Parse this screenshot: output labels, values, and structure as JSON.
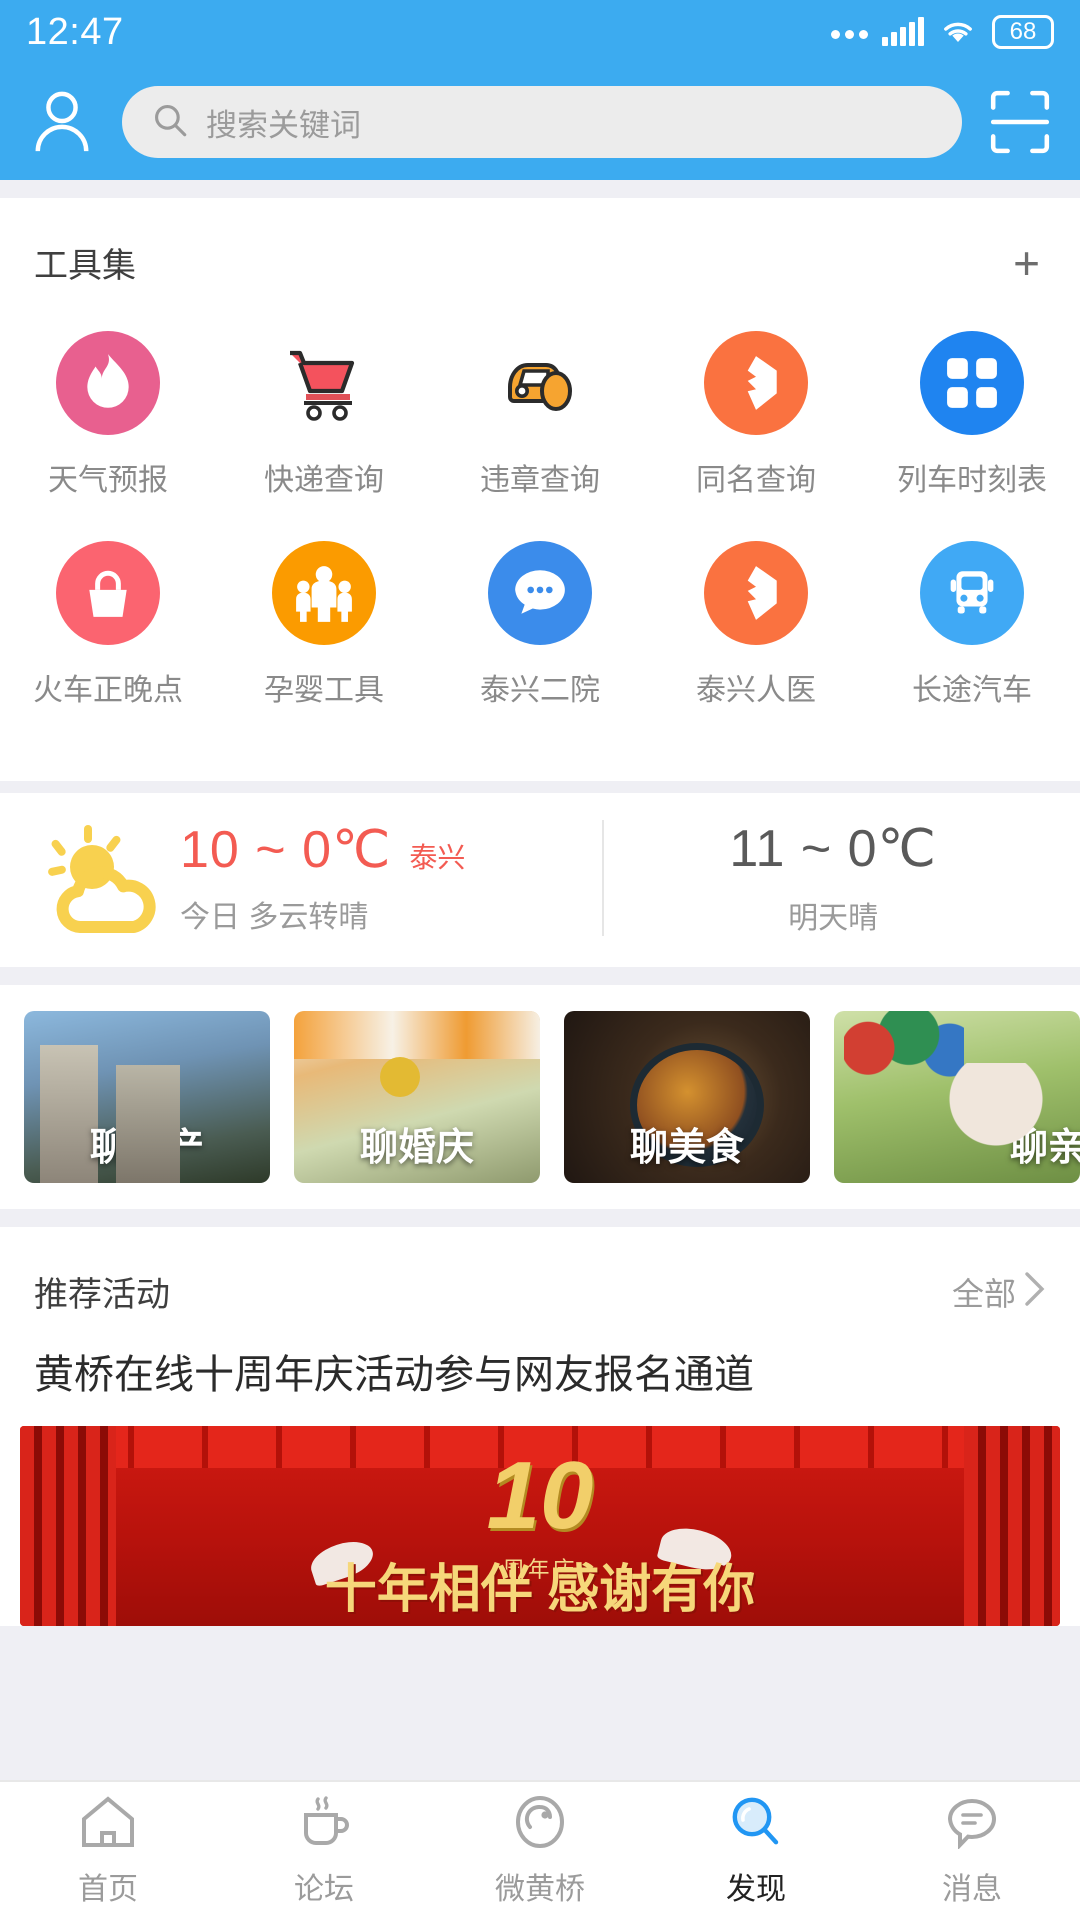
{
  "status_bar": {
    "time": "12:47",
    "battery": "68",
    "icons": [
      "more-dots-icon",
      "cellular-signal-icon",
      "wifi-icon",
      "battery-icon"
    ]
  },
  "header": {
    "profile_icon": "person-icon",
    "search": {
      "placeholder": "搜索关键词",
      "icon": "search-icon"
    },
    "scan_icon": "scan-icon",
    "bg_color": "#3cabf0"
  },
  "toolset": {
    "title": "工具集",
    "add_label": "+",
    "items": [
      {
        "label": "天气预报",
        "icon": "flame-icon",
        "bg": "#e8608f",
        "fg": "#ffffff"
      },
      {
        "label": "快递查询",
        "icon": "shopping-cart-icon",
        "bg": "transparent",
        "fg": "#f4525d"
      },
      {
        "label": "违章查询",
        "icon": "car-icon",
        "bg": "transparent",
        "fg": "#f6a430"
      },
      {
        "label": "同名查询",
        "icon": "bolt-tag-icon",
        "bg": "#fa7240",
        "fg": "#ffffff"
      },
      {
        "label": "列车时刻表",
        "icon": "grid-blocks-icon",
        "bg": "#1f84f0",
        "fg": "#ffffff"
      },
      {
        "label": "火车正晚点",
        "icon": "basket-icon",
        "bg": "#fb6470",
        "fg": "#ffffff"
      },
      {
        "label": "孕婴工具",
        "icon": "family-icon",
        "bg": "#fb9b00",
        "fg": "#ffffff"
      },
      {
        "label": "泰兴二院",
        "icon": "chat-bubble-icon",
        "bg": "#3b8ceb",
        "fg": "#ffffff"
      },
      {
        "label": "泰兴人医",
        "icon": "bolt-tag-icon",
        "bg": "#fa7240",
        "fg": "#ffffff"
      },
      {
        "label": "长途汽车",
        "icon": "bus-icon",
        "bg": "#40a9f5",
        "fg": "#ffffff"
      }
    ]
  },
  "weather": {
    "icon": "sun-cloud-icon",
    "today": {
      "temp": "10 ~ 0℃",
      "city": "泰兴",
      "desc": "今日 多云转晴",
      "color": "#f35b52"
    },
    "tomorrow": {
      "temp": "11 ~ 0℃",
      "desc": "明天晴",
      "color": "#5a5a5a"
    }
  },
  "chat_cards": [
    {
      "label": "聊房产",
      "image": "apartment-buildings-photo"
    },
    {
      "label": "聊婚庆",
      "image": "wedding-tent-photo"
    },
    {
      "label": "聊美食",
      "image": "noodle-bowl-photo"
    },
    {
      "label": "聊亲",
      "image": "balloons-family-photo"
    }
  ],
  "activities": {
    "section_title": "推荐活动",
    "more_label": "全部",
    "more_icon": "chevron-right-icon",
    "featured": {
      "title": "黄桥在线十周年庆活动参与网友报名通道",
      "banner": {
        "number": "10",
        "sub": "周年庆",
        "headline": "十年相伴  感谢有你",
        "image": "red-curtain-anniversary-banner"
      }
    }
  },
  "tabbar": {
    "active_index": 3,
    "active_color": "#2196f3",
    "items": [
      {
        "label": "首页",
        "icon": "home-icon"
      },
      {
        "label": "论坛",
        "icon": "coffee-cup-icon"
      },
      {
        "label": "微黄桥",
        "icon": "circle-swirl-icon"
      },
      {
        "label": "发现",
        "icon": "magnifier-icon"
      },
      {
        "label": "消息",
        "icon": "message-bubble-icon"
      }
    ]
  }
}
